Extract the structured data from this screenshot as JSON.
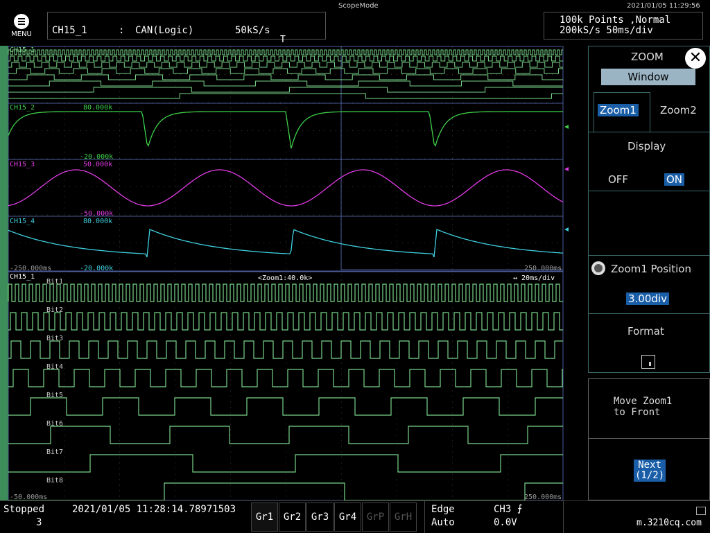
{
  "header": {
    "scope_mode": "ScopeMode",
    "datetime": "2021/01/05 11:29:56",
    "menu_label": "MENU",
    "trace_name": "CH15_1",
    "trace_sep": ":",
    "trace_type": "CAN(Logic)",
    "trace_rate": "50kS/s",
    "trigger_marker": "T",
    "acq_line1": "100k Points  ,Normal",
    "acq_line2": "200kS/s   50ms/div"
  },
  "main_window": {
    "channels": [
      {
        "name": "CH15_1",
        "color": "#7ad68a"
      },
      {
        "name": "CH15_2",
        "color": "#3fd14a",
        "top": "80.000k",
        "bottom": "-20.000k"
      },
      {
        "name": "CH15_3",
        "color": "#e23ce6",
        "top": "50.000k",
        "bottom": "-50.000k"
      },
      {
        "name": "CH15_4",
        "color": "#3fd0e0",
        "top": "80.000k",
        "bottom": "-20.000k"
      }
    ],
    "time_start": "-250.000ms",
    "time_end": "250.000ms"
  },
  "zoom_window": {
    "channel": "CH15_1",
    "zoom_label": "<Zoom1:40.0k>",
    "timebase": "↔ 20ms/div",
    "bits": [
      "Bit1",
      "Bit2",
      "Bit3",
      "Bit4",
      "Bit5",
      "Bit6",
      "Bit7",
      "Bit8"
    ],
    "time_start": "-50.000ms",
    "time_end": "250.000ms"
  },
  "panel": {
    "title": "ZOOM",
    "window_label": "Window",
    "zoom1_tab": "Zoom1",
    "zoom2_tab": "Zoom2",
    "display_label": "Display",
    "display_off": "OFF",
    "display_on": "ON",
    "position_label": "Zoom1 Position",
    "position_value": "3.00div",
    "format_label": "Format",
    "move_front_line1": "Move Zoom1",
    "move_front_line2": "to Front",
    "next_line1": "Next",
    "next_line2": "(1/2)"
  },
  "status": {
    "state": "Stopped",
    "count": "3",
    "timestamp": "2021/01/05 11:28:14.78971503",
    "groups": [
      {
        "label": "Gr1",
        "enabled": true
      },
      {
        "label": "Gr2",
        "enabled": true
      },
      {
        "label": "Gr3",
        "enabled": true
      },
      {
        "label": "Gr4",
        "enabled": true
      },
      {
        "label": "GrP",
        "enabled": false
      },
      {
        "label": "GrH",
        "enabled": false
      }
    ],
    "trigger_type": "Edge",
    "trigger_mode": "Auto",
    "trigger_source": "CH3",
    "trigger_level": "0.0V",
    "watermark": "m.3210cq.com"
  }
}
